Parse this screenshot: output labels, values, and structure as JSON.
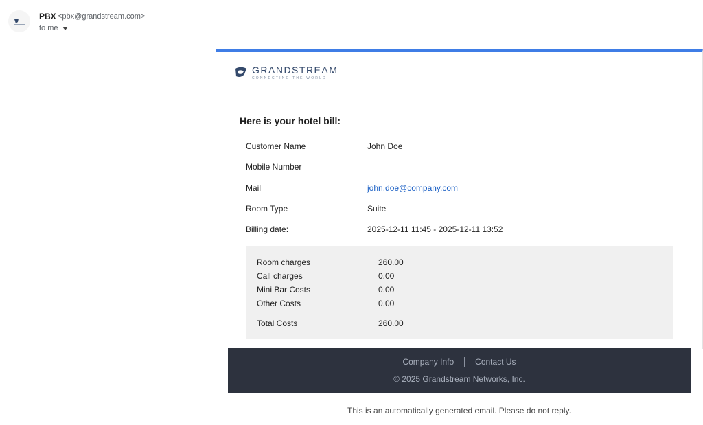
{
  "sender": {
    "name": "PBX",
    "email": "<pbx@grandstream.com>",
    "recipient": "to me"
  },
  "logo": {
    "title": "GRANDSTREAM",
    "tagline": "CONNECTING THE WORLD"
  },
  "bill": {
    "heading": "Here is your hotel bill:",
    "info": [
      {
        "label": "Customer Name",
        "value": "John Doe"
      },
      {
        "label": "Mobile Number",
        "value": ""
      },
      {
        "label": "Mail",
        "value": "john.doe@company.com"
      },
      {
        "label": "Room Type",
        "value": "Suite"
      },
      {
        "label": "Billing date:",
        "value": "2025-12-11 11:45 - 2025-12-11 13:52"
      }
    ],
    "charges": [
      {
        "label": "Room charges",
        "value": "260.00"
      },
      {
        "label": "Call charges",
        "value": "0.00"
      },
      {
        "label": "Mini Bar Costs",
        "value": "0.00"
      },
      {
        "label": "Other Costs",
        "value": "0.00"
      }
    ],
    "total": {
      "label": "Total Costs",
      "value": "260.00"
    }
  },
  "footer": {
    "links": [
      "Company Info",
      "Contact Us"
    ],
    "copyright": "© 2025 Grandstream Networks, Inc.",
    "note": "This is an automatically generated email. Please do not reply."
  },
  "colors": {
    "accent": "#3f7de6",
    "footer_bg": "#2d323e",
    "link": "#1a5fc4"
  }
}
